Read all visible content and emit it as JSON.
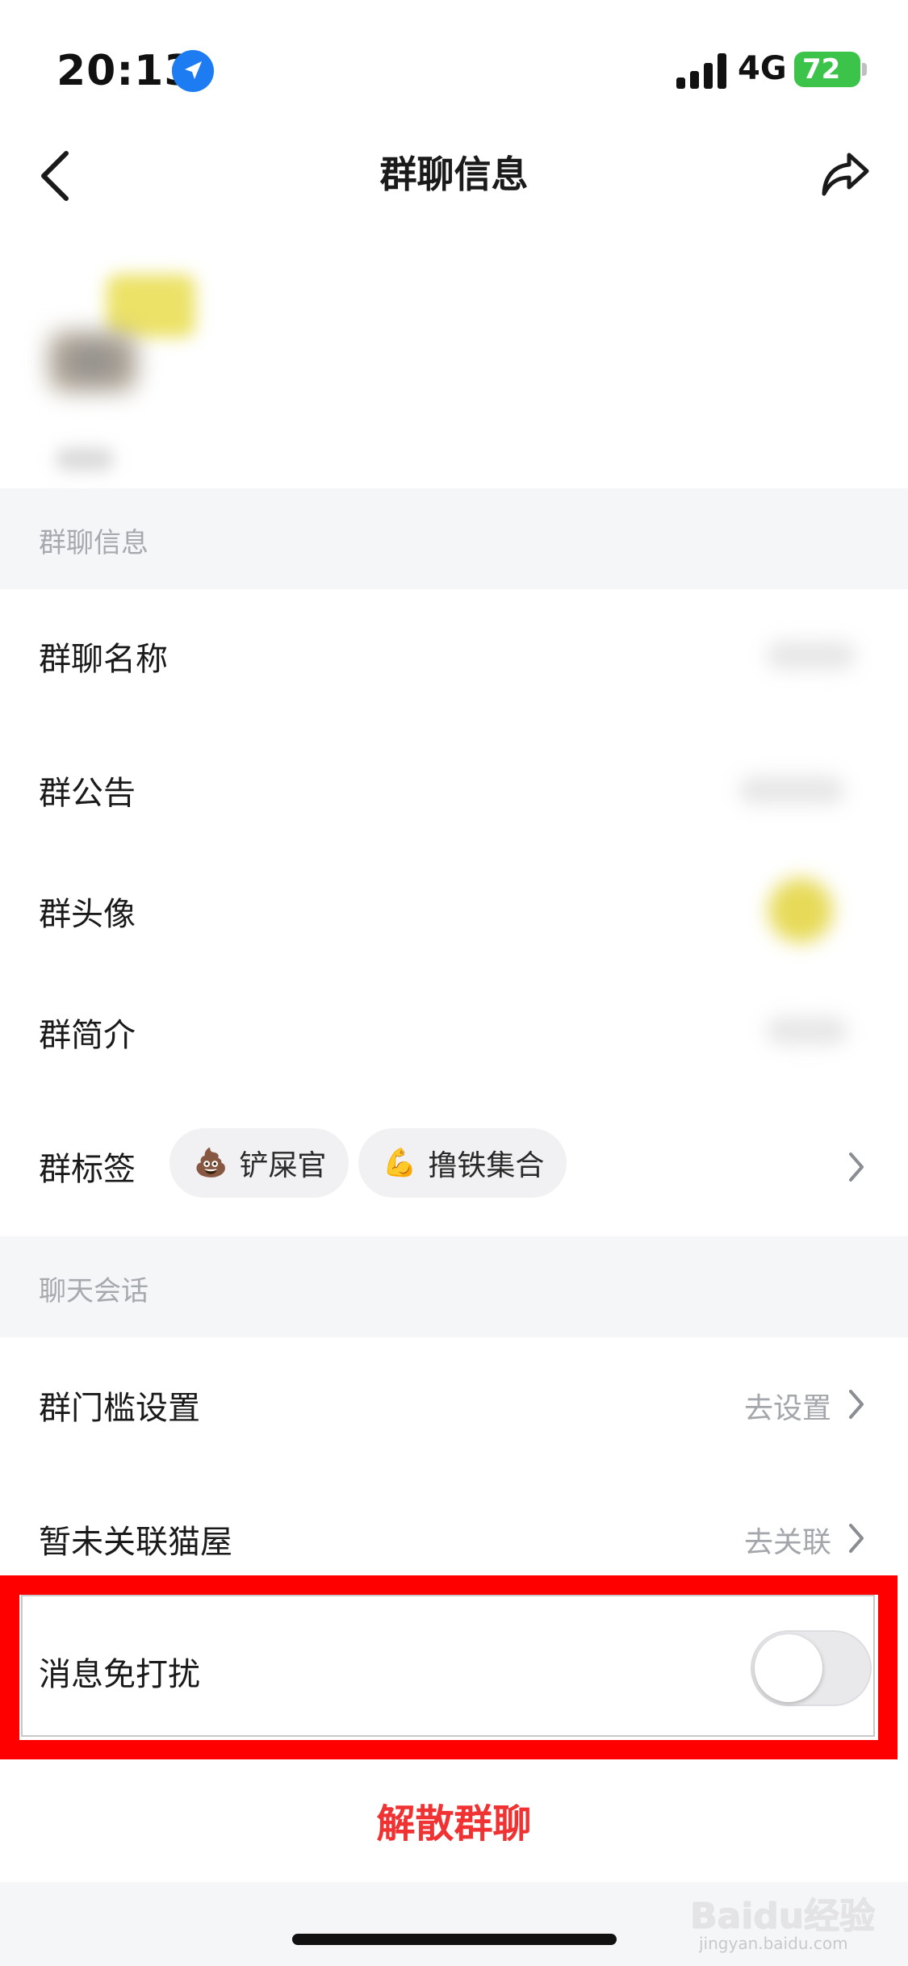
{
  "status_bar": {
    "time": "20:13",
    "network": "4G",
    "battery": "72"
  },
  "nav": {
    "title": "群聊信息"
  },
  "section_group_info": {
    "label": "群聊信息"
  },
  "rows": {
    "group_name": "群聊名称",
    "announcement": "群公告",
    "avatar": "群头像",
    "intro": "群简介",
    "tags": "群标签"
  },
  "tags": [
    {
      "emoji": "💩",
      "label": "铲屎官"
    },
    {
      "emoji": "💪",
      "label": "撸铁集合"
    }
  ],
  "section_chat": {
    "label": "聊天会话"
  },
  "threshold": {
    "label": "群门槛设置",
    "action": "去设置"
  },
  "cat_house": {
    "label": "暂未关联猫屋",
    "action": "去关联"
  },
  "mute": {
    "label": "消息免打扰",
    "enabled": false
  },
  "disband": {
    "label": "解散群聊"
  },
  "watermark": {
    "brand": "Baidu经验",
    "url": "jingyan.baidu.com"
  },
  "colors": {
    "accent_red": "#f03232",
    "highlight": "#ff0000",
    "section_bg": "#f5f6f8"
  }
}
